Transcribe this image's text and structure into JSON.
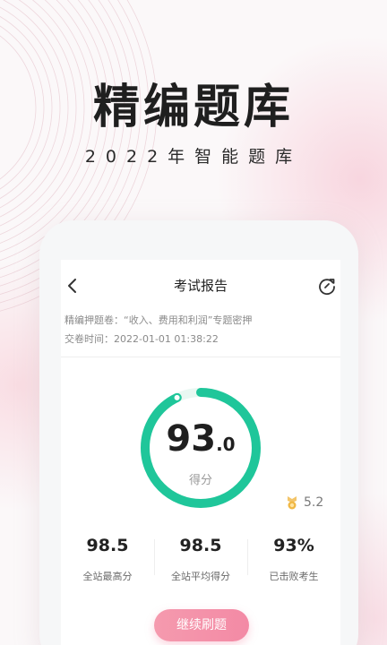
{
  "promo": {
    "headline": "精编题库",
    "subline": "2022年智能题库"
  },
  "nav": {
    "title": "考试报告"
  },
  "exam_info": {
    "paper": "精编押题卷：“收入、费用和利润”专题密押",
    "submit_time": "交卷时间：2022-01-01 01:38:22"
  },
  "score": {
    "main": "93",
    "fraction": ".0",
    "label": "得分",
    "progress": 0.93,
    "ring_color": "#1fc69a",
    "ring_track_color": "#e9f8f2"
  },
  "rank": {
    "value": "5.2",
    "icon": "medal-icon"
  },
  "stats": [
    {
      "value": "98.5",
      "label": "全站最高分"
    },
    {
      "value": "98.5",
      "label": "全站平均得分"
    },
    {
      "value": "93%",
      "label": "已击败考生"
    }
  ],
  "cta": {
    "label": "继续刷题",
    "color": "#f38aa5"
  }
}
